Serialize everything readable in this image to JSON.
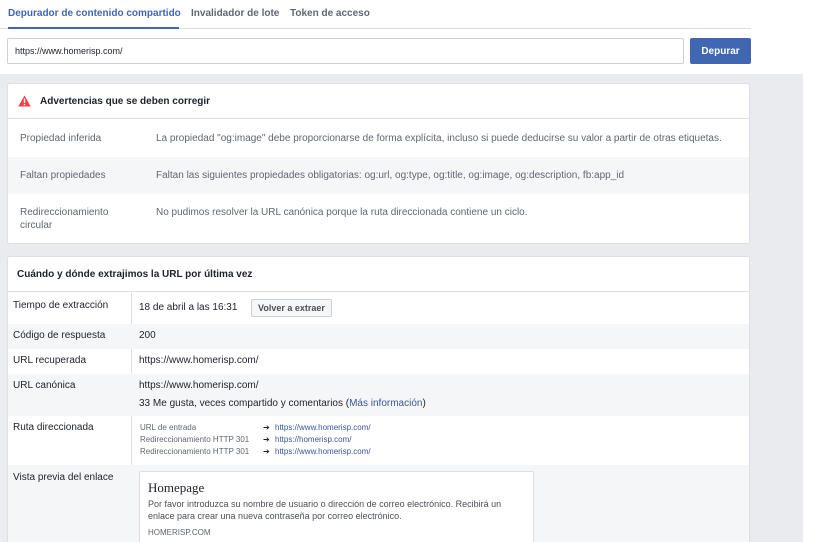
{
  "tabs": [
    {
      "label": "Depurador de contenido compartido",
      "active": true
    },
    {
      "label": "Invalidador de lote",
      "active": false
    },
    {
      "label": "Token de acceso",
      "active": false
    }
  ],
  "url_input": {
    "value": "https://www.homerisp.com/"
  },
  "debug_button": "Depurar",
  "warnings": {
    "title": "Advertencias que se deben corregir",
    "rows": [
      {
        "key": "Propiedad inferida",
        "value": "La propiedad \"og:image\" debe proporcionarse de forma explícita, incluso si puede deducirse su valor a partir de otras etiquetas."
      },
      {
        "key": "Faltan propiedades",
        "value": "Faltan las siguientes propiedades obligatorias: og:url, og:type, og:title, og:image, og:description, fb:app_id"
      },
      {
        "key_line1": "Redireccionamiento",
        "key_line2": "circular",
        "value": "No pudimos resolver la URL canónica porque la ruta direccionada contiene un ciclo."
      }
    ]
  },
  "fetch": {
    "title": "Cuándo y dónde extrajimos la URL por última vez",
    "time_label": "Tiempo de extracción",
    "time_value": "18 de abril a las 16:31",
    "refetch_button": "Volver a extraer",
    "response_label": "Código de respuesta",
    "response_value": "200",
    "fetched_url_label": "URL recuperada",
    "fetched_url_value": "https://www.homerisp.com/",
    "canonical_label": "URL canónica",
    "canonical_value": "https://www.homerisp.com/",
    "likes_text": "33 Me gusta, veces compartido y comentarios (",
    "more_info": "Más información",
    "likes_close": ")",
    "redirect_label": "Ruta direccionada",
    "redirects": [
      {
        "label": "URL de entrada",
        "url": "https://www.homerisp.com/"
      },
      {
        "label": "Redireccionamiento HTTP 301",
        "url": "https://homerisp.com/"
      },
      {
        "label": "Redireccionamiento HTTP 301",
        "url": "https://www.homerisp.com/"
      }
    ],
    "arrow": "➔",
    "preview_label": "Vista previa del enlace",
    "preview": {
      "title": "Homepage",
      "description": "Por favor introduzca su nombre de usuario o dirección de correo electrónico. Recibirá un enlace para crear una nueva contraseña por correo electrónico.",
      "domain": "HOMERISP.COM"
    }
  },
  "colors": {
    "accent": "#4267b2",
    "link": "#365899",
    "warning": "#fa3e3e"
  }
}
